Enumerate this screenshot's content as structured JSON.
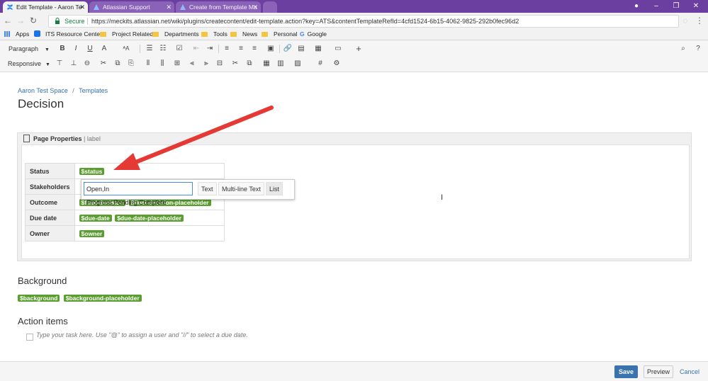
{
  "browser": {
    "tabs": [
      {
        "label": "Edit Template - Aaron Te",
        "active": true
      },
      {
        "label": "Atlassian Support",
        "active": false
      },
      {
        "label": "Create from Template Ma",
        "active": false
      }
    ],
    "secure_label": "Secure",
    "url": "https://meckits.atlassian.net/wiki/plugins/createcontent/edit-template.action?key=ATS&contentTemplateRefId=4cfd1524-6b15-4062-9825-292b0fec96d2",
    "bookmarks": [
      "Apps",
      "ITS Resource Center",
      "Project Related",
      "Departments",
      "Tools",
      "News",
      "Personal",
      "Google"
    ]
  },
  "toolbar": {
    "paragraph_label": "Paragraph",
    "layout_label": "Responsive"
  },
  "breadcrumb": {
    "space": "Aaron Test Space",
    "separator": "/",
    "section": "Templates"
  },
  "page_title": "Decision",
  "page_properties": {
    "title": "Page Properties",
    "label_suffix": "| label",
    "rows": [
      {
        "header": "Status",
        "tags": [
          "$status"
        ]
      },
      {
        "header": "Stakeholders",
        "tags": []
      },
      {
        "header": "Outcome",
        "tags": [
          "$final-decision",
          "$final-decision-placeholder"
        ]
      },
      {
        "header": "Due date",
        "tags": [
          "$due-date",
          "$due-date-placeholder"
        ]
      },
      {
        "header": "Owner",
        "tags": [
          "$owner"
        ]
      }
    ]
  },
  "variable_popup": {
    "input_value": "Open,In Progress,Pending,Complete",
    "types": [
      "Text",
      "Multi-line Text",
      "List"
    ]
  },
  "background": {
    "heading": "Background",
    "tags": [
      "$background",
      "$background-placeholder"
    ]
  },
  "action_items": {
    "heading": "Action items",
    "placeholder": "Type your task here. Use \"@\" to assign a user and \"//\" to select a due date."
  },
  "footer": {
    "save": "Save",
    "preview": "Preview",
    "cancel": "Cancel"
  },
  "colors": {
    "accent": "#3b73af",
    "tag_green": "#5a9e2f",
    "chrome_purple": "#6b3fa0",
    "arrow_red": "#e53935"
  }
}
